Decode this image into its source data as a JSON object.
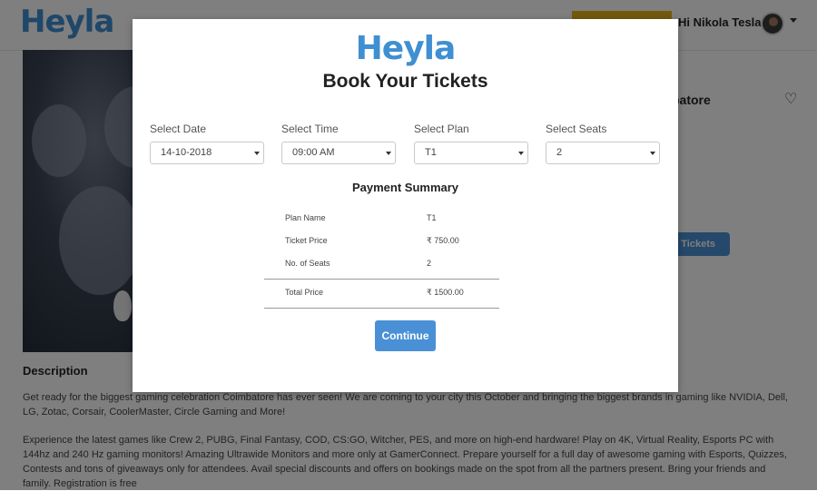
{
  "header": {
    "logo": "Heyla",
    "greeting": "Hi Nikola Tesla !"
  },
  "event": {
    "title_fragment": "batore",
    "tickets_button": "r Tickets",
    "description_title": "Description",
    "description_p1": "Get ready for the biggest gaming celebration Coimbatore has ever seen! We are coming to your city this October and bringing the biggest brands in gaming like NVIDIA, Dell, LG, Zotac, Corsair, CoolerMaster, Circle Gaming and More!",
    "description_p2": "Experience the latest games like Crew 2, PUBG, Final Fantasy, COD, CS:GO, Witcher, PES, and more on high-end hardware! Play on 4K, Virtual Reality, Esports PC with 144hz and 240 Hz gaming monitors! Amazing Ultrawide Monitors and more only at GamerConnect. Prepare yourself for a full day of awesome gaming with Esports, Quizzes, Contests and tons of giveaways only for attendees. Avail special discounts and offers on bookings made on the spot from all the partners present. Bring your friends and family. Registration is free"
  },
  "modal": {
    "logo": "Heyla",
    "title": "Book Your Tickets",
    "fields": [
      {
        "label": "Select Date",
        "value": "14-10-2018"
      },
      {
        "label": "Select Time",
        "value": "09:00 AM"
      },
      {
        "label": "Select Plan",
        "value": "T1"
      },
      {
        "label": "Select Seats",
        "value": "2"
      }
    ],
    "summary_title": "Payment Summary",
    "summary_rows": [
      {
        "label": "Plan Name",
        "value": "T1"
      },
      {
        "label": "Ticket Price",
        "value": "₹ 750.00"
      },
      {
        "label": "No. of Seats",
        "value": "2"
      }
    ],
    "total": {
      "label": "Total Price",
      "value": "₹ 1500.00"
    },
    "continue_label": "Continue"
  },
  "colors": {
    "brand": "#3f8fd2",
    "button": "#4a90d6",
    "header_accent": "#e8b21a"
  }
}
